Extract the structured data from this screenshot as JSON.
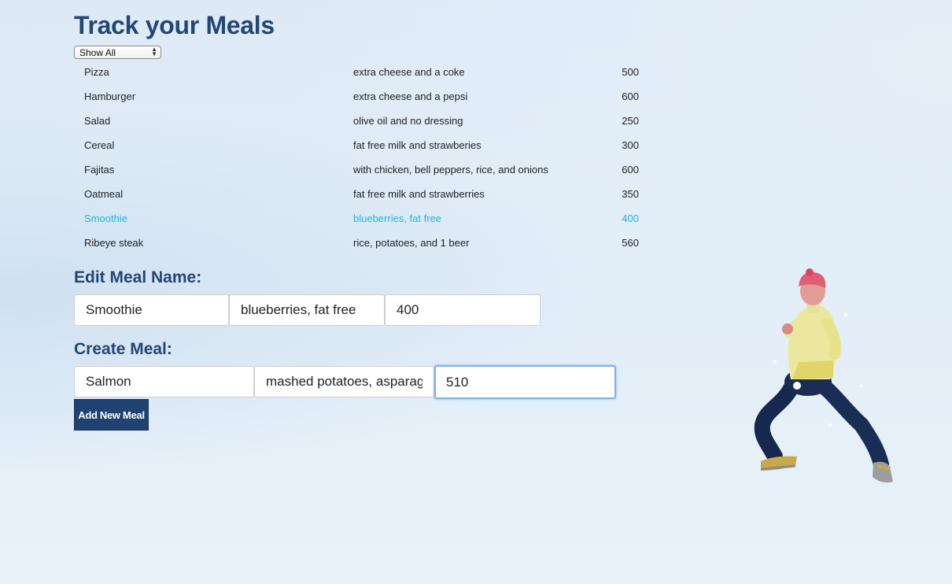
{
  "page": {
    "title": "Track your Meals"
  },
  "filter": {
    "selected": "Show All"
  },
  "meals": [
    {
      "name": "Pizza",
      "details": "extra cheese and a coke",
      "calories": "500"
    },
    {
      "name": "Hamburger",
      "details": "extra cheese and a pepsi",
      "calories": "600"
    },
    {
      "name": "Salad",
      "details": "olive oil and no dressing",
      "calories": "250"
    },
    {
      "name": "Cereal",
      "details": "fat free milk and strawberies",
      "calories": "300"
    },
    {
      "name": "Fajitas",
      "details": "with chicken, bell peppers, rice, and onions",
      "calories": "600"
    },
    {
      "name": "Oatmeal",
      "details": "fat free milk and strawberries",
      "calories": "350"
    },
    {
      "name": "Smoothie",
      "details": "blueberries, fat free",
      "calories": "400"
    },
    {
      "name": "Ribeye steak",
      "details": "rice, potatoes, and 1 beer",
      "calories": "560"
    }
  ],
  "selected_meal_index": 6,
  "edit_form": {
    "heading": "Edit Meal Name:",
    "name_value": "Smoothie",
    "details_value": "blueberries, fat free",
    "calories_value": "400"
  },
  "create_form": {
    "heading": "Create Meal:",
    "name_value": "Salmon",
    "details_value": "mashed potatoes, asparagus",
    "calories_value": "510",
    "submit_label": "Add New Meal"
  },
  "colors": {
    "heading": "#234676",
    "selected_row": "#22b3e3",
    "button_bg": "#1f4273",
    "background": "#ddeaf6"
  }
}
